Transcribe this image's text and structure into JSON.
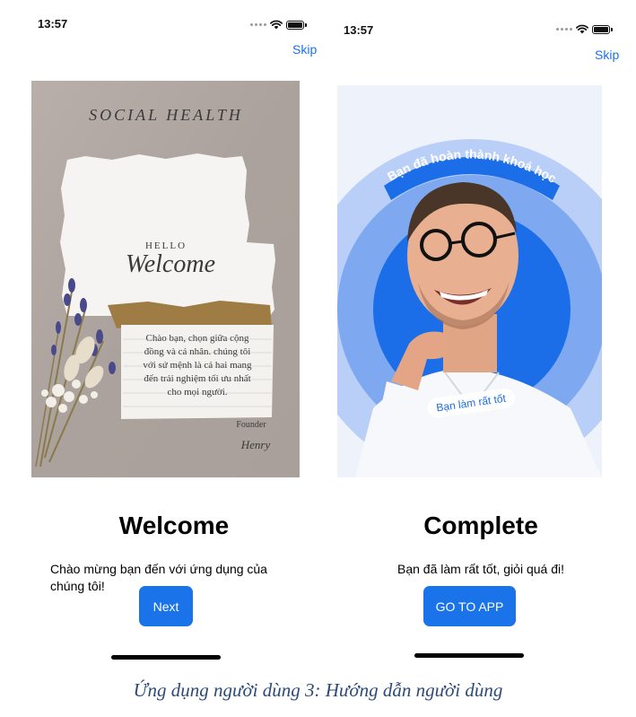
{
  "left_screen": {
    "status_time": "13:57",
    "skip_label": "Skip",
    "card": {
      "brand": "SOCIAL HEALTH",
      "hello": "HELLO",
      "welcome_script": "Welcome",
      "message_lines": [
        "Chào bạn, chọn giữa cộng",
        "đồng và cá nhân. chúng tôi",
        "với sứ mệnh là cả hai mang",
        "đến trải nghiệm tối ưu nhất",
        "cho mọi người."
      ],
      "founder": "Founder",
      "signature": "Henry"
    },
    "title": "Welcome",
    "description": "Chào mừng bạn đến với ứng dụng của chúng tôi!",
    "button_label": "Next"
  },
  "right_screen": {
    "status_time": "13:57",
    "skip_label": "Skip",
    "illustration": {
      "banner_text": "Bạn đã hoàn thành khoá học",
      "badge_text": "Bạn làm rất tốt"
    },
    "title": "Complete",
    "description": "Bạn đã làm rất tốt, giỏi quá đi!",
    "button_label": "GO TO APP"
  },
  "caption": "Ứng dụng người dùng 3: Hướng dẫn người dùng",
  "colors": {
    "accent": "#1a73e8",
    "card_background": "#b5aba7",
    "illustration_background": "#eef2fb",
    "circle_outer": "#b9cff7",
    "circle_mid": "#7ea8f0",
    "circle_inner": "#1c6ee8",
    "caption": "#2b4a78"
  },
  "icons": [
    "wifi-icon",
    "battery-icon",
    "signal-dots-icon"
  ]
}
